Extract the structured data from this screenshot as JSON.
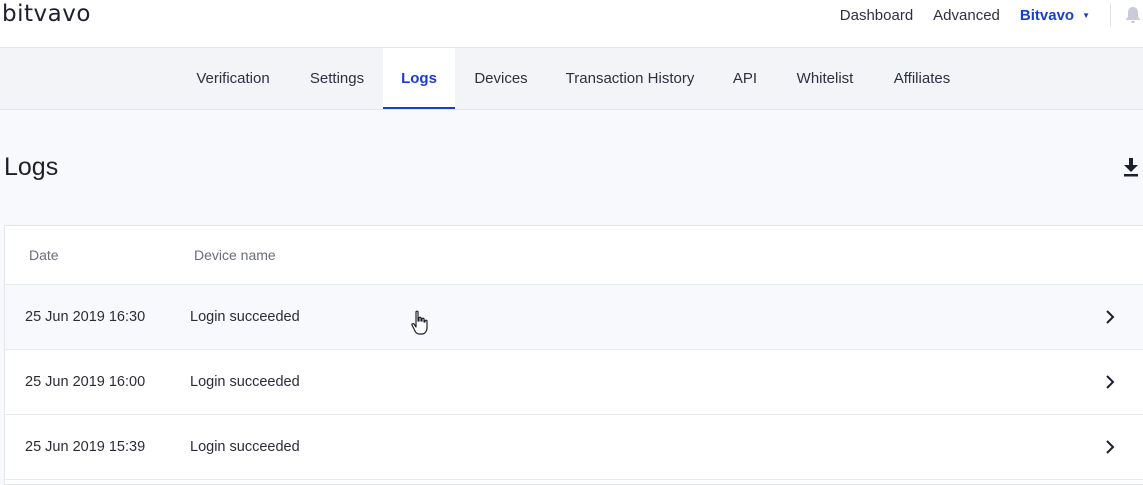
{
  "header": {
    "logo": "bitvavo",
    "nav": {
      "dashboard": "Dashboard",
      "advanced": "Advanced",
      "account": "Bitvavo",
      "caret_icon": "caret-down-icon",
      "bell_icon": "bell-icon"
    }
  },
  "subnav": {
    "tabs": [
      {
        "label": "Verification"
      },
      {
        "label": "Settings"
      },
      {
        "label": "Logs",
        "active": true
      },
      {
        "label": "Devices"
      },
      {
        "label": "Transaction History"
      },
      {
        "label": "API"
      },
      {
        "label": "Whitelist"
      },
      {
        "label": "Affiliates"
      }
    ]
  },
  "page": {
    "title": "Logs",
    "download_icon": "download-icon"
  },
  "table": {
    "columns": [
      "Date",
      "Device name"
    ],
    "rows": [
      {
        "date": "25 Jun 2019 16:30",
        "event": "Login succeeded"
      },
      {
        "date": "25 Jun 2019 16:00",
        "event": "Login succeeded"
      },
      {
        "date": "25 Jun 2019 15:39",
        "event": "Login succeeded"
      }
    ]
  },
  "colors": {
    "accent": "#1a3fc4",
    "text": "#2b2b3a",
    "muted": "#6a6c7c",
    "page_bg": "#f8f9fc"
  }
}
